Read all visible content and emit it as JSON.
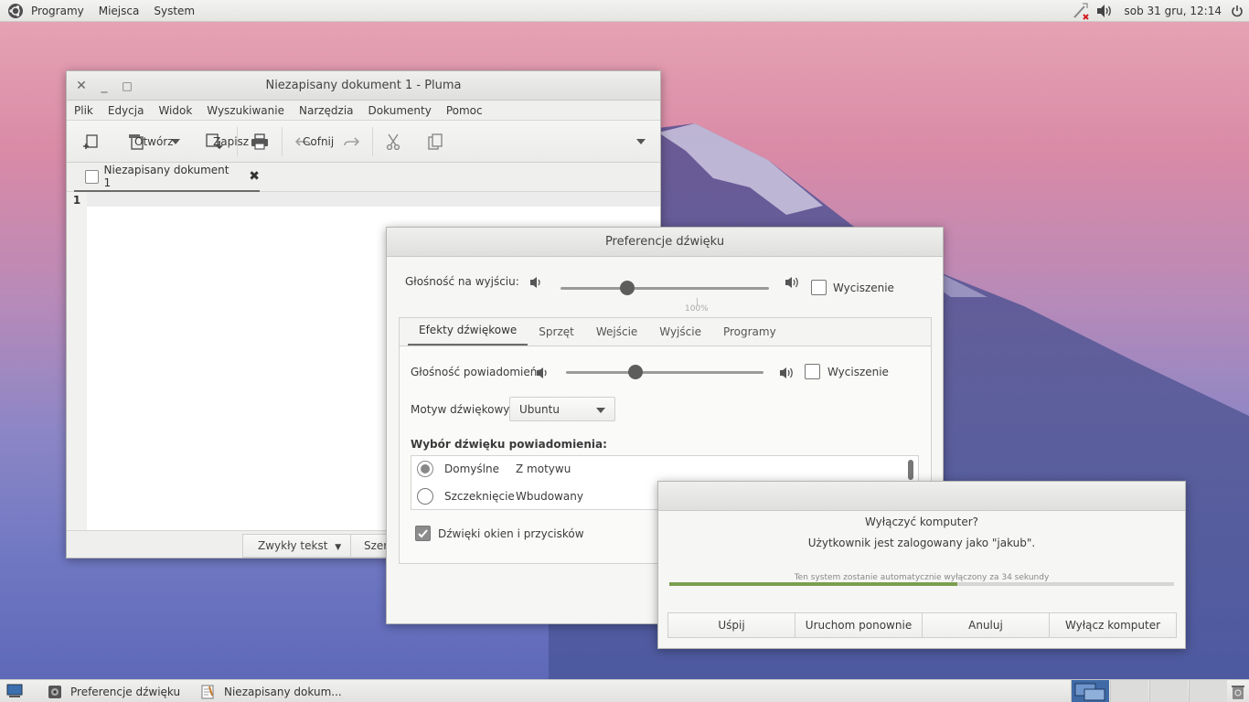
{
  "top_panel": {
    "menu_programs": "Programy",
    "menu_places": "Miejsca",
    "menu_system": "System",
    "clock": "sob 31 gru, 12:14"
  },
  "pluma": {
    "title": "Niezapisany dokument 1 - Pluma",
    "menu": [
      "Plik",
      "Edycja",
      "Widok",
      "Wyszukiwanie",
      "Narzędzia",
      "Dokumenty",
      "Pomoc"
    ],
    "toolbar": {
      "open": "Otwórz",
      "save": "Zapisz",
      "undo": "Cofnij"
    },
    "tab_label": "Niezapisany dokument 1",
    "line_number": "1",
    "status": {
      "highlight_mode": "Zwykły tekst",
      "tab_width": "Szer"
    }
  },
  "sound": {
    "title": "Preferencje dźwięku",
    "output_volume_label": "Głośność na wyjściu:",
    "output_volume_percent": 32,
    "mark_100": "100%",
    "mute_label": "Wyciszenie",
    "tabs": [
      "Efekty dźwiękowe",
      "Sprzęt",
      "Wejście",
      "Wyjście",
      "Programy"
    ],
    "alert_volume_label": "Głośność powiadomień:",
    "alert_volume_percent": 35,
    "alert_mute_label": "Wyciszenie",
    "theme_label": "Motyw dźwiękowy:",
    "theme_value": "Ubuntu",
    "alert_choice_label": "Wybór dźwięku powiadomienia:",
    "alerts": [
      {
        "name": "Domyślne",
        "type": "Z motywu"
      },
      {
        "name": "Szczeknięcie",
        "type": "Wbudowany"
      }
    ],
    "window_sounds_label": "Dźwięki okien i przycisków"
  },
  "shutdown": {
    "question": "Wyłączyć komputer?",
    "user_info": "Użytkownik jest zalogowany jako \"jakub\".",
    "countdown": "Ten system zostanie automatycznie wyłączony za 34 sekundy",
    "progress": 0.57,
    "buttons": [
      "Uśpij",
      "Uruchom ponownie",
      "Anuluj",
      "Wyłącz komputer"
    ]
  },
  "taskbar": {
    "items": [
      "Preferencje dźwięku",
      "Niezapisany dokum..."
    ]
  },
  "colors": {
    "progress": "#7a9e4f",
    "panel": "#ebebe9"
  }
}
